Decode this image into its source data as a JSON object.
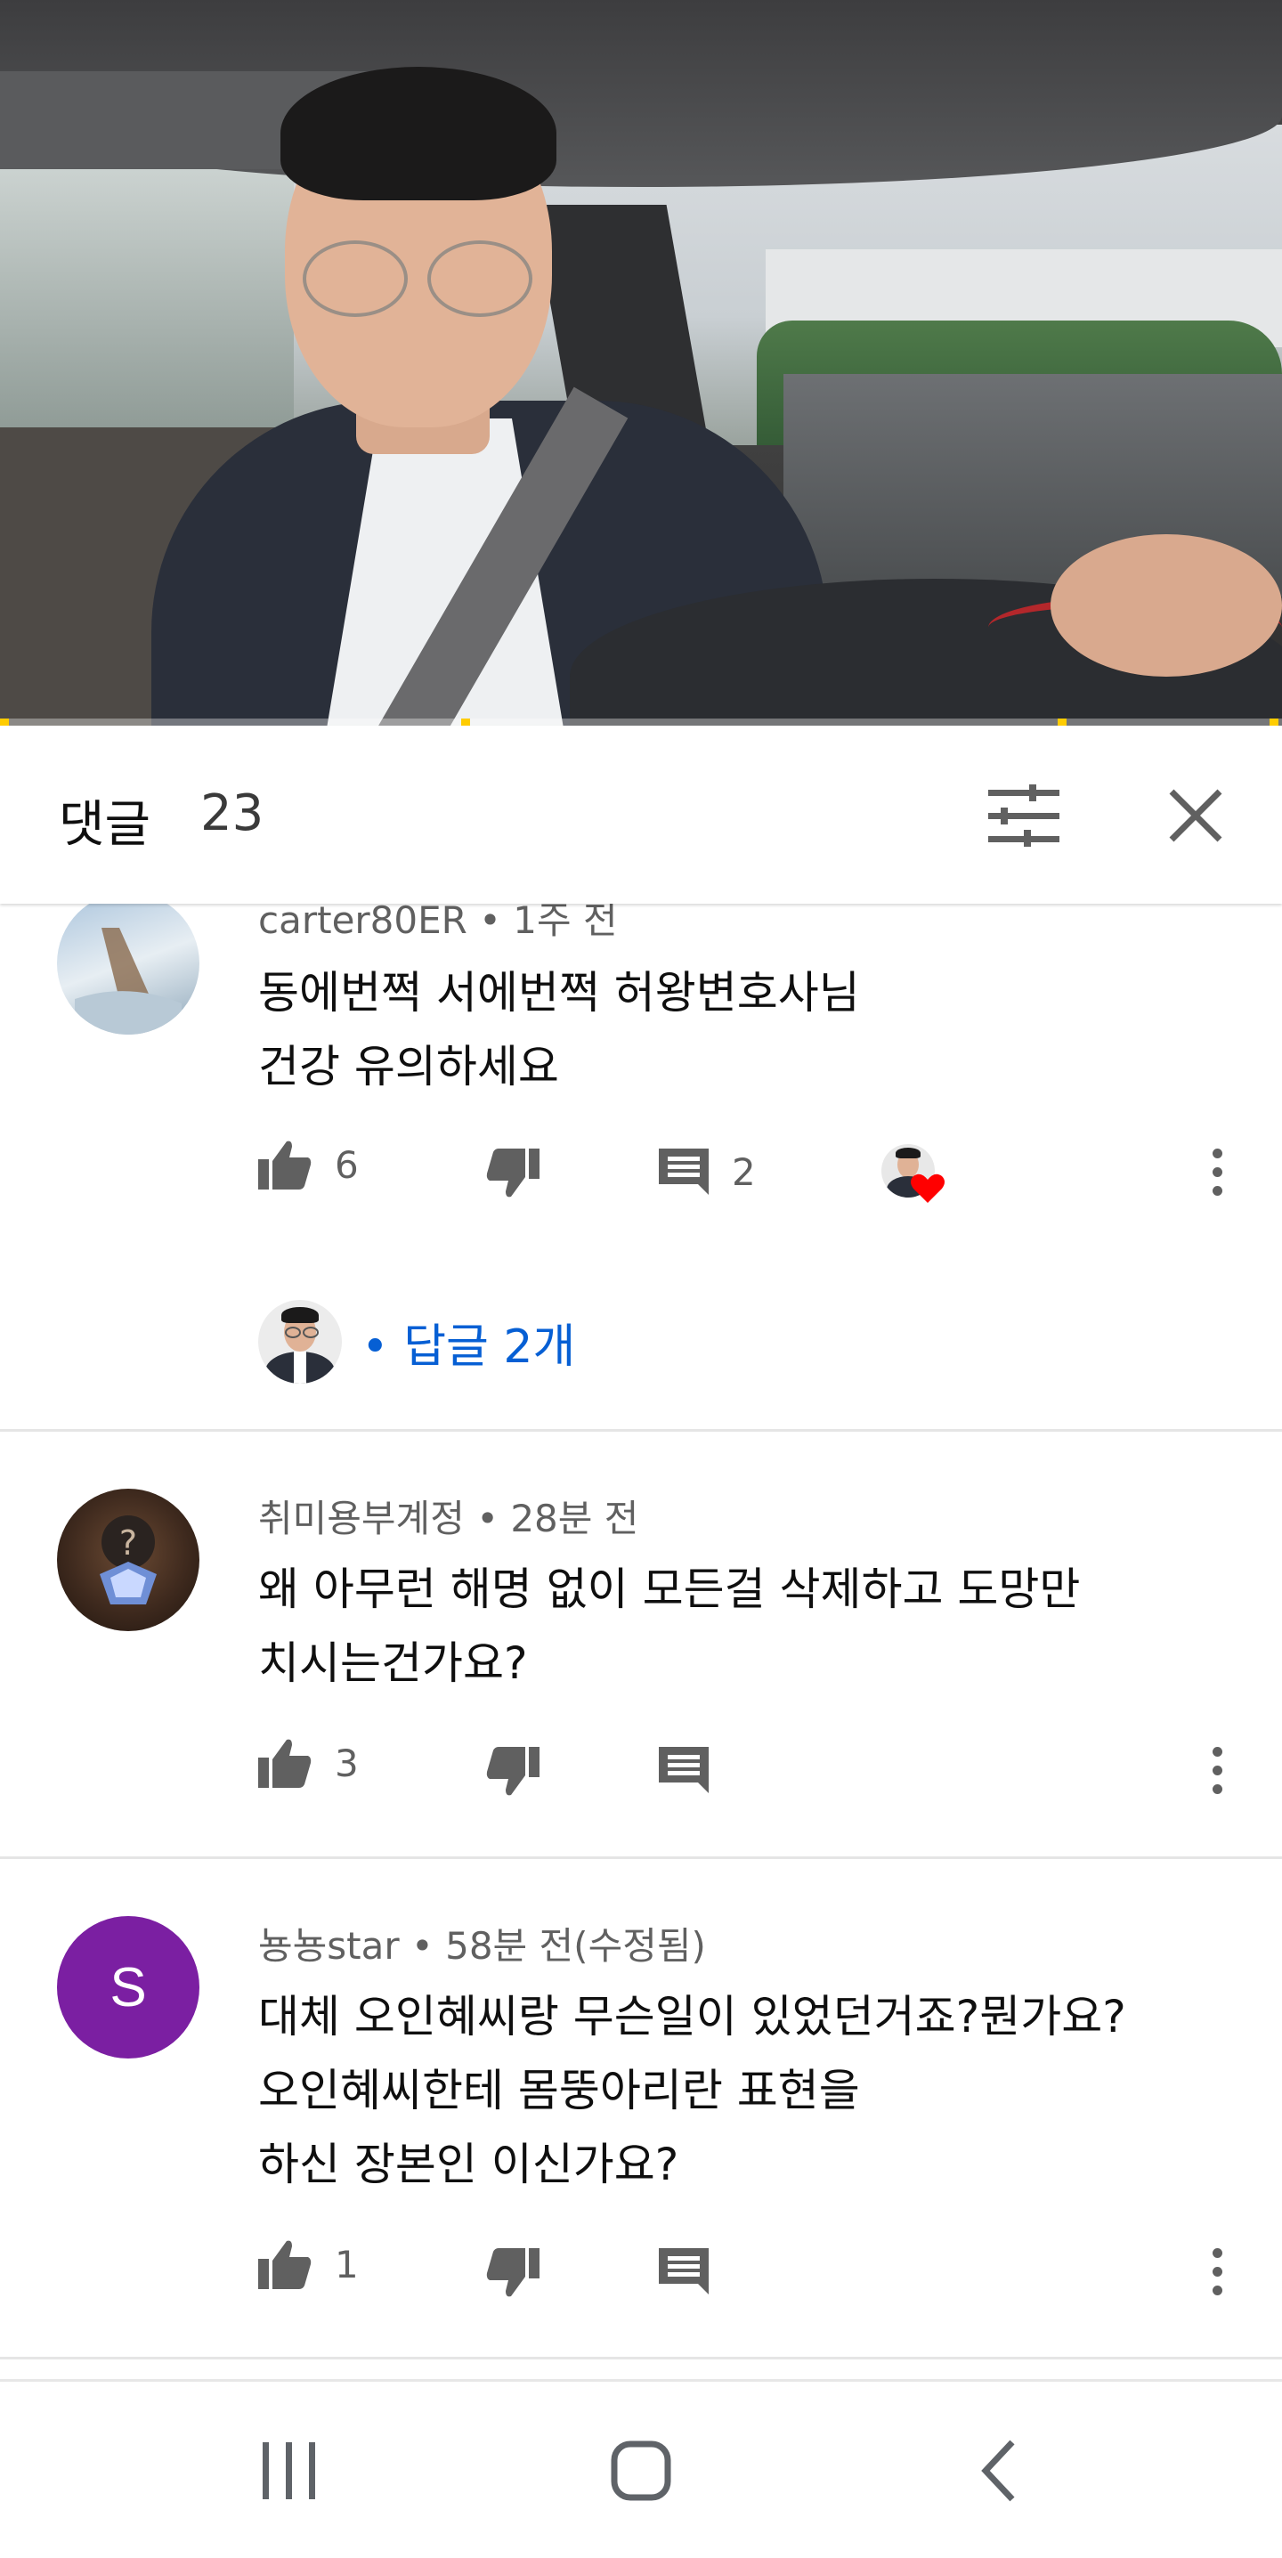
{
  "video": {
    "progress_fraction": 0.0
  },
  "header": {
    "title": "댓글",
    "count": "23",
    "sort_icon": "sort-sliders-icon",
    "close_icon": "close-icon"
  },
  "comments": [
    {
      "author": "carter80ER",
      "time": "1주 전",
      "meta": "carter80ER • 1주 전",
      "lines": [
        "동에번쩍 서에번쩍  허왕변호사님",
        "건강 유의하세요"
      ],
      "likes": "6",
      "reply_count": "2",
      "has_creator_heart": true
    },
    {
      "author": "취미용부계정",
      "time": "28분 전",
      "meta": "취미용부계정 • 28분 전",
      "lines": [
        "왜 아무런 해명 없이 모든걸 삭제하고 도망만",
        "치시는건가요?"
      ],
      "likes": "3",
      "reply_count": ""
    },
    {
      "author": "뇽뇽star",
      "time": "58분 전(수정됨)",
      "meta": "뇽뇽star • 58분 전(수정됨)",
      "avatar_letter": "S",
      "avatar_color": "#7b1fa2",
      "lines": [
        "대체 오인혜씨랑 무슨일이 있었던거죠?뭔가요?",
        "오인혜씨한테 몸뚱아리란 표현을",
        "하신 장본인 이신가요?"
      ],
      "likes": "1",
      "reply_count": ""
    }
  ],
  "replies_link": {
    "label": "• 답글 2개"
  },
  "colors": {
    "link": "#065fd4",
    "heart": "#ff0000",
    "icon": "#606060"
  },
  "navbar": {
    "items": [
      "recent-apps-icon",
      "home-icon",
      "back-icon"
    ]
  }
}
